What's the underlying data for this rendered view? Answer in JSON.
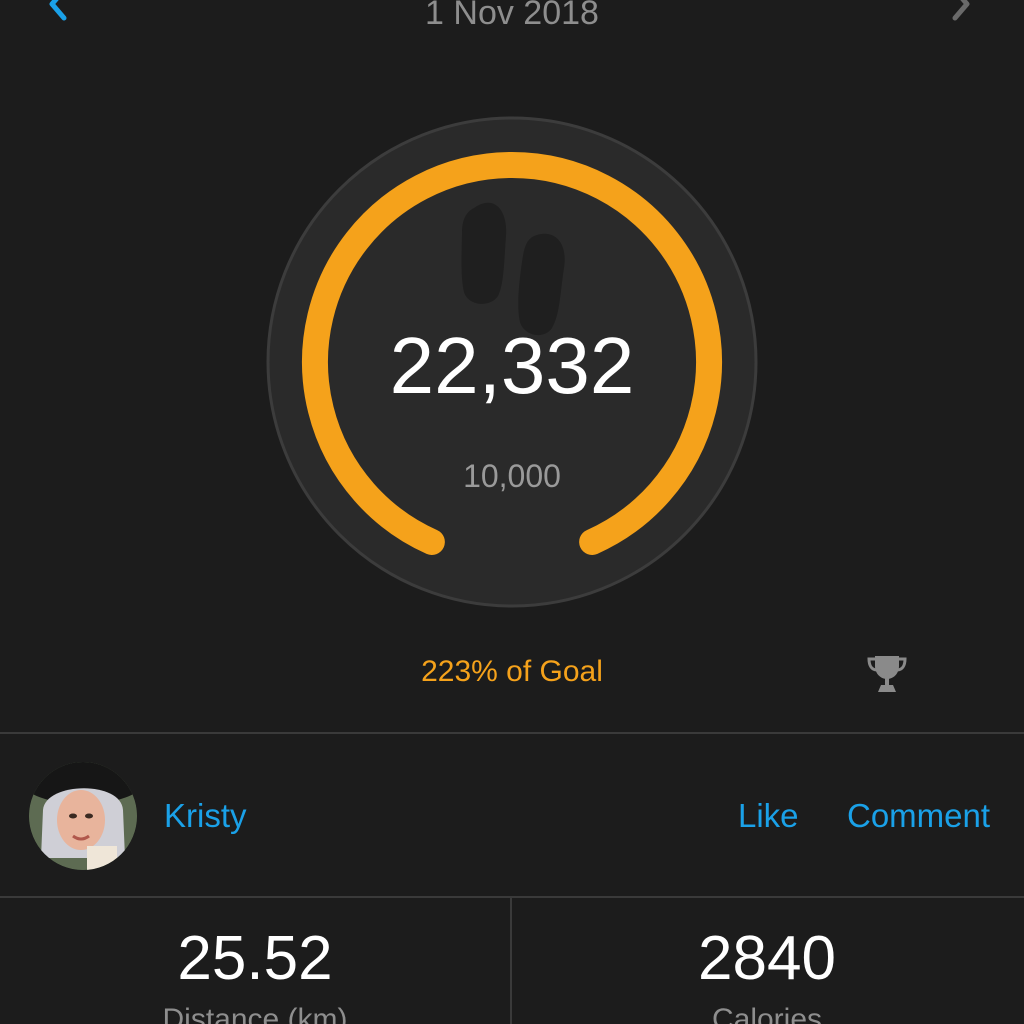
{
  "header": {
    "date": "1 Nov 2018",
    "prev_icon": "chevron-left-icon",
    "next_icon": "chevron-right-icon"
  },
  "steps": {
    "value": "22,332",
    "goal": "10,000",
    "percent_label": "223% of Goal",
    "progress_fraction": 1.0,
    "icon": "footprints-icon",
    "goal_icon": "trophy-icon"
  },
  "social": {
    "user_name": "Kristy",
    "like_label": "Like",
    "comment_label": "Comment"
  },
  "stats": [
    {
      "value": "25.52",
      "label": "Distance (km)"
    },
    {
      "value": "2840",
      "label": "Calories"
    }
  ],
  "colors": {
    "background": "#1c1c1c",
    "accent_orange": "#f5a21b",
    "link_blue": "#1aa1e8",
    "gauge_face": "#2a2a2a",
    "divider": "#3a3a3a"
  }
}
